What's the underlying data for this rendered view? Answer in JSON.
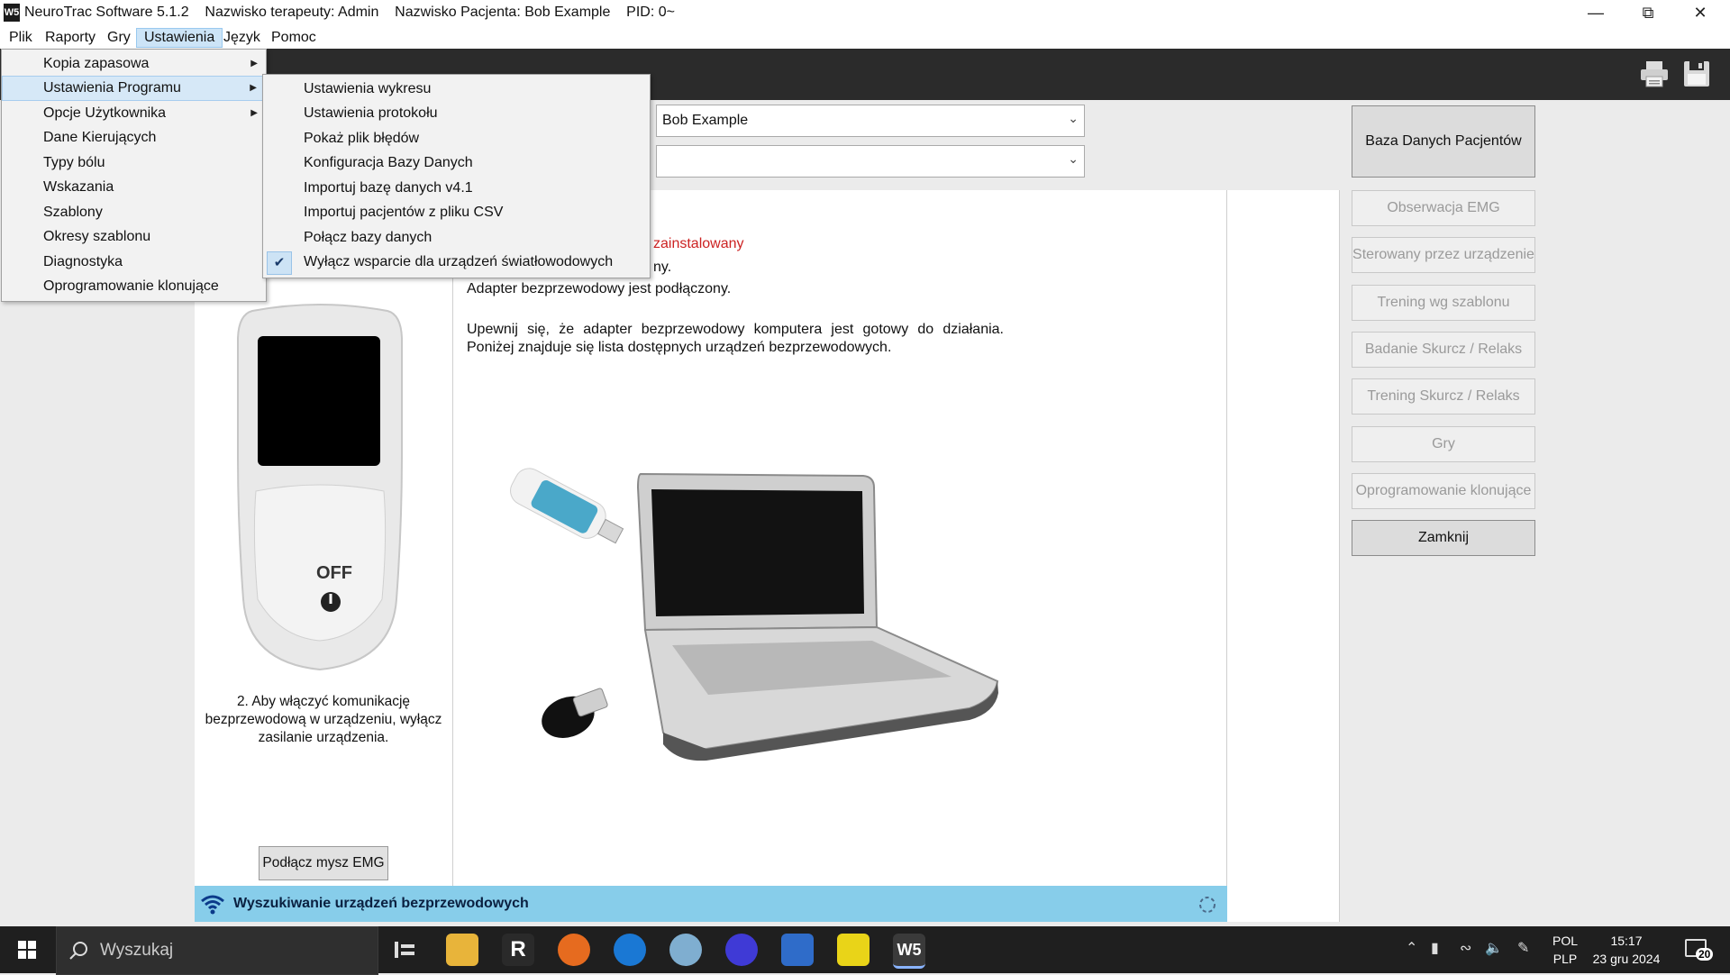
{
  "window": {
    "app_title": "NeuroTrac Software 5.1.2",
    "therapist": "Nazwisko terapeuty: Admin",
    "patient": "Nazwisko Pacjenta: Bob Example",
    "pid": "PID: 0~",
    "logo_text": "W5"
  },
  "menubar": {
    "items": [
      {
        "label": "Plik"
      },
      {
        "label": "Raporty"
      },
      {
        "label": "Gry"
      },
      {
        "label": "Ustawienia"
      },
      {
        "label": "Język"
      },
      {
        "label": "Pomoc"
      }
    ]
  },
  "settings_menu": {
    "items": [
      {
        "label": "Kopia zapasowa",
        "submenu": true
      },
      {
        "label": "Ustawienia Programu",
        "submenu": true
      },
      {
        "label": "Opcje Użytkownika",
        "submenu": true
      },
      {
        "label": "Dane Kierujących"
      },
      {
        "label": "Typy bólu"
      },
      {
        "label": "Wskazania"
      },
      {
        "label": "Szablony"
      },
      {
        "label": "Okresy szablonu"
      },
      {
        "label": "Diagnostyka"
      },
      {
        "label": "Oprogramowanie klonujące"
      }
    ]
  },
  "program_settings_submenu": {
    "items": [
      {
        "label": "Ustawienia wykresu"
      },
      {
        "label": "Ustawienia protokołu"
      },
      {
        "label": "Pokaż plik błędów"
      },
      {
        "label": "Konfiguracja Bazy Danych"
      },
      {
        "label": "Importuj bazę danych v4.1"
      },
      {
        "label": "Importuj pacjentów z pliku CSV"
      },
      {
        "label": "Połącz bazy danych"
      },
      {
        "label": "Wyłącz wsparcie dla urządzeń światłowodowych",
        "checked": true
      }
    ]
  },
  "patient_select": {
    "value": "Bob Example",
    "second_value": ""
  },
  "main": {
    "line_installed": "zainstalowany",
    "line_partial": "ny.",
    "adapter_connected": "Adapter bezprzewodowy jest podłączony.",
    "instructions": "Upewnij się, że adapter bezprzewodowy komputera jest gotowy do działania. Poniżej znajduje się lista dostępnych urządzeń bezprzewodowych.",
    "device_label": "OFF",
    "step_text": "2. Aby włączyć komunikację bezprzewodową w urządzeniu, wyłącz zasilanie urządzenia.",
    "connect_mouse_button": "Podłącz mysz EMG"
  },
  "status": {
    "text": "Wyszukiwanie urządzeń bezprzewodowych"
  },
  "right_panel": {
    "db_button": "Baza Danych Pacjentów",
    "buttons": [
      {
        "label": "Obserwacja EMG"
      },
      {
        "label": "Sterowany przez urządzenie"
      },
      {
        "label": "Trening wg szablonu"
      },
      {
        "label": "Badanie Skurcz / Relaks"
      },
      {
        "label": "Trening Skurcz / Relaks"
      },
      {
        "label": "Gry"
      },
      {
        "label": "Oprogramowanie klonujące"
      }
    ],
    "close_button": "Zamknij"
  },
  "taskbar": {
    "search_placeholder": "Wyszukaj",
    "lang_top": "POL",
    "lang_bottom": "PLP",
    "time": "15:17",
    "date": "23 gru 2024",
    "notifications": "20"
  },
  "colors": {
    "status_bar": "#87cdea",
    "error_text": "#cc2222",
    "toolbar": "#2b2b2b"
  }
}
